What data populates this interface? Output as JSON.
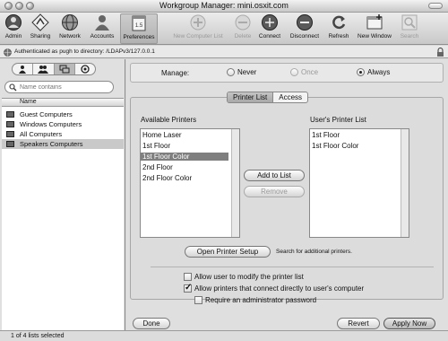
{
  "window": {
    "title": "Workgroup Manager: mini.osxit.com"
  },
  "toolbar": {
    "items": [
      {
        "label": "Admin",
        "icon": "admin-icon"
      },
      {
        "label": "Sharing",
        "icon": "sharing-icon"
      },
      {
        "label": "Network",
        "icon": "network-icon"
      },
      {
        "label": "Accounts",
        "icon": "accounts-icon"
      },
      {
        "label": "Preferences",
        "icon": "preferences-icon"
      },
      {
        "label": "New Computer List",
        "icon": "add-icon"
      },
      {
        "label": "Delete",
        "icon": "delete-icon"
      },
      {
        "label": "Connect",
        "icon": "connect-icon"
      },
      {
        "label": "Disconnect",
        "icon": "disconnect-icon"
      },
      {
        "label": "Refresh",
        "icon": "refresh-icon"
      },
      {
        "label": "New Window",
        "icon": "new-window-icon"
      },
      {
        "label": "Search",
        "icon": "search-icon"
      }
    ],
    "prefs_badge": "1.5"
  },
  "auth": {
    "text": "Authenticated as pugh to directory: /LDAPv3/127.0.0.1"
  },
  "sidebar": {
    "search_placeholder": "Name contains",
    "column_header": "Name",
    "items": [
      {
        "label": "Guest Computers",
        "selected": false
      },
      {
        "label": "Windows Computers",
        "selected": false
      },
      {
        "label": "All Computers",
        "selected": false
      },
      {
        "label": "Speakers Computers",
        "selected": true
      }
    ],
    "status": "1 of 4 lists selected"
  },
  "manage": {
    "label": "Manage:",
    "options": [
      {
        "label": "Never",
        "selected": false,
        "enabled": true
      },
      {
        "label": "Once",
        "selected": false,
        "enabled": false
      },
      {
        "label": "Always",
        "selected": true,
        "enabled": true
      }
    ]
  },
  "tabs": [
    {
      "label": "Printer List",
      "selected": true
    },
    {
      "label": "Access",
      "selected": false
    }
  ],
  "printers": {
    "available_title": "Available Printers",
    "available": [
      "Home Laser",
      "1st Floor",
      "1st Floor Color",
      "2nd Floor",
      "2nd Floor Color"
    ],
    "available_selected_index": 2,
    "user_title": "User's Printer List",
    "user_list": [
      "1st Floor",
      "1st Floor Color"
    ],
    "add_button": "Add to List",
    "remove_button": "Remove",
    "setup_button": "Open Printer Setup",
    "setup_note": "Search for additional printers."
  },
  "options": [
    {
      "label": "Allow user to modify the printer list",
      "checked": false
    },
    {
      "label": "Allow printers that connect directly to user's computer",
      "checked": true
    },
    {
      "label": "Require an administrator password",
      "checked": false
    }
  ],
  "footer": {
    "done": "Done",
    "revert": "Revert",
    "apply": "Apply Now"
  }
}
